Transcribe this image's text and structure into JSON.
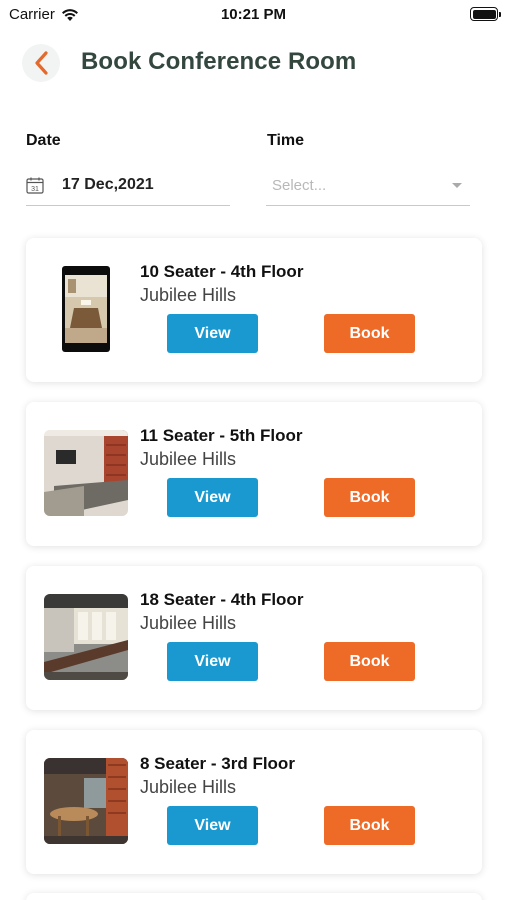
{
  "status_bar": {
    "carrier": "Carrier",
    "time": "10:21 PM"
  },
  "header": {
    "title": "Book Conference Room",
    "back_icon": "chevron-left-icon"
  },
  "filters": {
    "date_label": "Date",
    "date_value": "17 Dec,2021",
    "date_icon": "calendar-icon",
    "date_icon_text": "31",
    "time_label": "Time",
    "time_placeholder": "Select..."
  },
  "colors": {
    "view_button": "#1999cf",
    "book_button": "#ee6b27",
    "title": "#33473f",
    "back_chevron": "#e36a2c"
  },
  "rooms": [
    {
      "name": "10 Seater - 4th Floor",
      "location": "Jubilee Hills",
      "view_label": "View",
      "book_label": "Book"
    },
    {
      "name": "11 Seater - 5th Floor",
      "location": "Jubilee Hills",
      "view_label": "View",
      "book_label": "Book"
    },
    {
      "name": "18 Seater - 4th Floor",
      "location": "Jubilee Hills",
      "view_label": "View",
      "book_label": "Book"
    },
    {
      "name": "8 Seater - 3rd Floor",
      "location": "Jubilee Hills",
      "view_label": "View",
      "book_label": "Book"
    }
  ]
}
